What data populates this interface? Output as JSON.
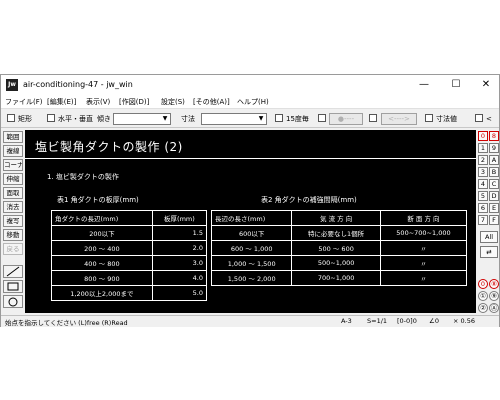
{
  "window": {
    "title": "air-conditioning-47 - jw_win",
    "app_icon": "Jw",
    "minimize": "—",
    "maximize": "☐",
    "close": "✕"
  },
  "menu": [
    "ファイル(F)",
    "[編集(E)]",
    "表示(V)",
    "[作図(D)]",
    "設定(S)",
    "[その他(A)]",
    "ヘルプ(H)"
  ],
  "toolbar": {
    "rect": "矩形",
    "hv": "水平・垂直",
    "angle": "傾き",
    "dim": "寸法",
    "dim15": "15度毎",
    "btn1": "●----",
    "btn2": "<---->",
    "dimval": "寸法値",
    "lt": "<"
  },
  "left_palette": [
    "範囲",
    "複線",
    "コーナー",
    "伸縮",
    "面取",
    "消去",
    "複写",
    "移動",
    "戻る"
  ],
  "right_palette": {
    "rows": [
      [
        "0",
        "8"
      ],
      [
        "1",
        "9"
      ],
      [
        "2",
        "A"
      ],
      [
        "3",
        "B"
      ],
      [
        "4",
        "C"
      ],
      [
        "5",
        "D"
      ],
      [
        "6",
        "E"
      ],
      [
        "7",
        "F"
      ]
    ],
    "all": "All",
    "swap": "⇄",
    "bottom": [
      "0",
      "⑧",
      "①",
      "⑨",
      "②",
      "Ⓐ"
    ]
  },
  "drawing": {
    "title": "塩ビ製角ダクトの製作 (2)",
    "section": "1. 塩ビ製ダクトの製作",
    "table1": {
      "caption": "表1 角ダクトの板厚(mm)",
      "headers": [
        "角ダクトの長辺(mm)",
        "板厚(mm)"
      ],
      "rows": [
        [
          "200以下",
          "1.5"
        ],
        [
          "200 ～ 400",
          "2.0"
        ],
        [
          "400 ～ 800",
          "3.0"
        ],
        [
          "800 ～ 900",
          "4.0"
        ],
        [
          "1,200以上2,000まで",
          "5.0"
        ]
      ]
    },
    "table2": {
      "caption": "表2 角ダクトの補強間隔(mm)",
      "headers": [
        "長辺の長さ(mm)",
        "気 流 方 向",
        "断 面 方 向"
      ],
      "rows": [
        [
          "600以下",
          "特に必要なし1個所",
          "500~700~1,000"
        ],
        [
          "600 ～ 1,000",
          "500 ～ 600",
          "〃"
        ],
        [
          "1,000 ～ 1,500",
          "500~1,000",
          "〃"
        ],
        [
          "1,500 ～ 2,000",
          "700~1,000",
          "〃"
        ]
      ]
    }
  },
  "status": {
    "message": "始点を指示してください (L)free (R)Read",
    "paper": "A-3",
    "scale": "S=1/1",
    "layer": "[0-0]0",
    "angle": "∠0",
    "zoom": "× 0.56"
  }
}
